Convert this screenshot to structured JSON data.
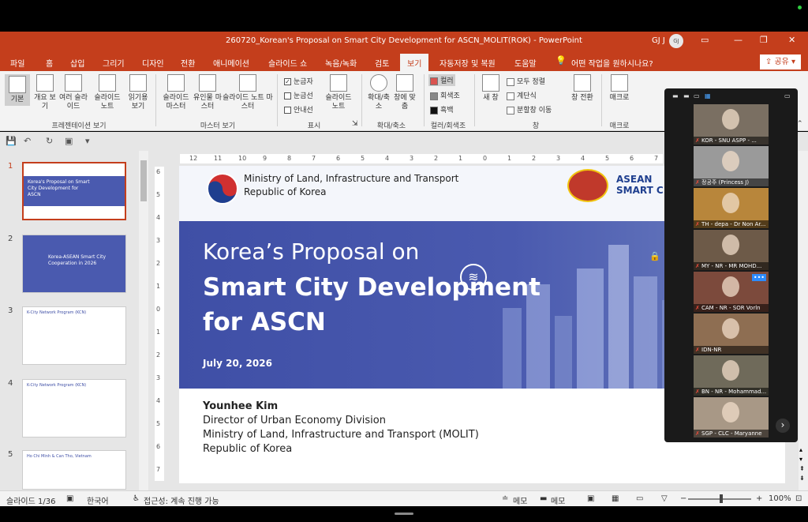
{
  "window": {
    "title": "260720_Korean's Proposal on Smart City Development for ASCN_MOLIT(ROK)  -  PowerPoint",
    "user": "GJ J",
    "user_initials": "GJ"
  },
  "tabs": [
    "파일",
    "홈",
    "삽입",
    "그리기",
    "디자인",
    "전환",
    "애니메이션",
    "슬라이드 쇼",
    "녹음/녹화",
    "검토",
    "보기",
    "자동저장 및 복원",
    "도움말"
  ],
  "active_tab": "보기",
  "help_search": "어떤 작업을 원하시나요?",
  "share_label": "공유",
  "ribbon": {
    "presentation_views": [
      "기본",
      "개요 보기",
      "여러 슬라이드",
      "슬라이드 노트",
      "읽기용 보기"
    ],
    "presentation_views_group": "프레젠테이션 보기",
    "master_views": [
      "슬라이드 마스터",
      "유인물 마스터",
      "슬라이드 노트 마스터"
    ],
    "master_views_group": "마스터 보기",
    "show_items": [
      "눈금자",
      "눈금선",
      "안내선"
    ],
    "show_notes": "슬라이드 노트",
    "show_group": "표시",
    "zoom_items": [
      "확대/축소",
      "창에 맞춤"
    ],
    "zoom_group": "확대/축소",
    "color_items": [
      "컬러",
      "회색조",
      "흑백"
    ],
    "color_group": "컬러/회색조",
    "window_items": [
      "새 창",
      "모두 정렬",
      "계단식",
      "분할창 이동"
    ],
    "window_group": "창",
    "switch_window": "창 전환",
    "macro": "매크로",
    "macro_group": "매크로"
  },
  "thumbnails": [
    {
      "num": "1",
      "text": "Korea's Proposal on Smart City Development for ASCN"
    },
    {
      "num": "2",
      "text": "Korea-ASEAN Smart City Cooperation in 2026"
    },
    {
      "num": "3",
      "text": "K-City Network Program (KCN)"
    },
    {
      "num": "4",
      "text": "K-City Network Program (KCN)"
    },
    {
      "num": "5",
      "text": "Ho Chi Minh & Can Tho, Vietnam"
    }
  ],
  "ruler_h": [
    "12",
    "11",
    "10",
    "9",
    "8",
    "7",
    "6",
    "5",
    "4",
    "3",
    "2",
    "1",
    "0",
    "1",
    "2",
    "3",
    "4",
    "5",
    "6",
    "7"
  ],
  "ruler_v": [
    "6",
    "5",
    "4",
    "3",
    "2",
    "1",
    "0",
    "1",
    "2",
    "3",
    "4",
    "5",
    "6",
    "7"
  ],
  "slide": {
    "ministry_line1": "Ministry of Land, Infrastructure and Transport",
    "ministry_line2": "Republic of Korea",
    "asean_line1": "ASEAN",
    "asean_line2": "SMART C",
    "title_line1": "Korea’s Proposal on",
    "title_line2": "Smart City Development",
    "title_line3": "for ASCN",
    "date": "July 20, 2026",
    "presenter_name": "Younhee Kim",
    "presenter_line1": "Director of Urban Economy Division",
    "presenter_line2": "Ministry of Land, Infrastructure and Transport (MOLIT)",
    "presenter_line3": "Republic of Korea"
  },
  "participants": [
    "KOR - SNU ASPP - ...",
    "정공주 (Princess J)",
    "TH - depa - Dr Non Ar...",
    "MY - NR - MR MOHD...",
    "CAM - NR - SOR Vorln",
    "IDN-NR",
    "BN - NR - Mohammad...",
    "SGP - CLC - Maryanne"
  ],
  "status": {
    "slide_counter": "슬라이드 1/36",
    "language": "한국어",
    "accessibility": "접근성: 계속 진행 가능",
    "notes": "메모",
    "comments": "메모",
    "zoom": "100%"
  }
}
